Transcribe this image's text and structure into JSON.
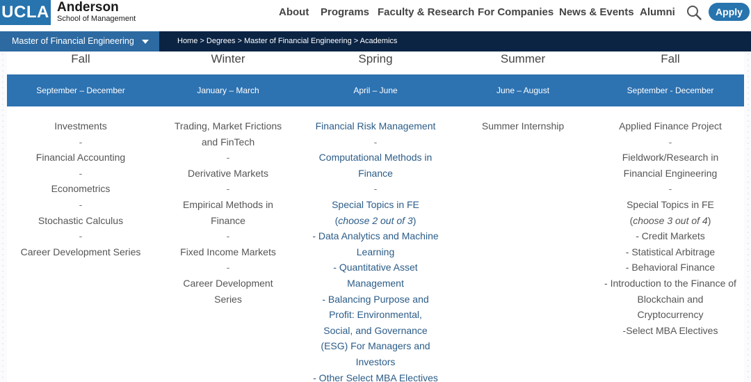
{
  "header": {
    "logo_ucla": "UCLA",
    "logo_name": "Anderson",
    "logo_sub": "School of Management",
    "nav": [
      "About",
      "Programs",
      "Faculty & Research",
      "For Companies",
      "News & Events",
      "Alumni"
    ],
    "apply_label": "Apply"
  },
  "subnav": {
    "program": "Master of Financial Engineering",
    "breadcrumb": "Home > Degrees > Master of Financial Engineering > Academics"
  },
  "seasons": [
    {
      "name": "Fall",
      "dates": "September – December"
    },
    {
      "name": "Winter",
      "dates": "January – March"
    },
    {
      "name": "Spring",
      "dates": "April – June"
    },
    {
      "name": "Summer",
      "dates": "June – August"
    },
    {
      "name": "Fall",
      "dates": "September - December"
    }
  ],
  "columns": {
    "fall1": [
      "Investments",
      "-",
      "Financial Accounting",
      "-",
      "Econometrics",
      "-",
      "Stochastic Calculus",
      "-",
      "Career Development Series"
    ],
    "winter": [
      "Trading, Market Frictions and FinTech",
      "-",
      "Derivative Markets",
      "-",
      "Empirical Methods in Finance",
      "-",
      "Fixed Income Markets",
      "-",
      "Career Development Series"
    ],
    "spring": {
      "c1": "Financial Risk Management",
      "sep": "-",
      "c2": "Computational Methods in Finance",
      "c3": "Special Topics in FE",
      "choose_open": "(",
      "choose": "choose 2 out of 3",
      "choose_close": ")",
      "c4": "- Data Analytics and Machine Learning",
      "c5": "- Quantitative Asset Management",
      "c6": "- Balancing Purpose and Profit: Environmental, Social, and Governance (ESG) For Managers and Investors",
      "c7": "- Other Select MBA Electives"
    },
    "summer": [
      "Summer Internship"
    ],
    "fall2": {
      "c1": "Applied Finance Project",
      "sep": "-",
      "c2": "Fieldwork/Research in Financial Engineering",
      "c3": "Special Topics in FE",
      "choose_open": "(",
      "choose": "choose 3 out of 4",
      "choose_close": ")",
      "c4": "- Credit Markets",
      "c5": "- Statistical Arbitrage",
      "c6": "- Behavioral Finance",
      "c7": "- Introduction to the Finance of Blockchain and Cryptocurrency",
      "c8": "-Select MBA Electives"
    }
  }
}
